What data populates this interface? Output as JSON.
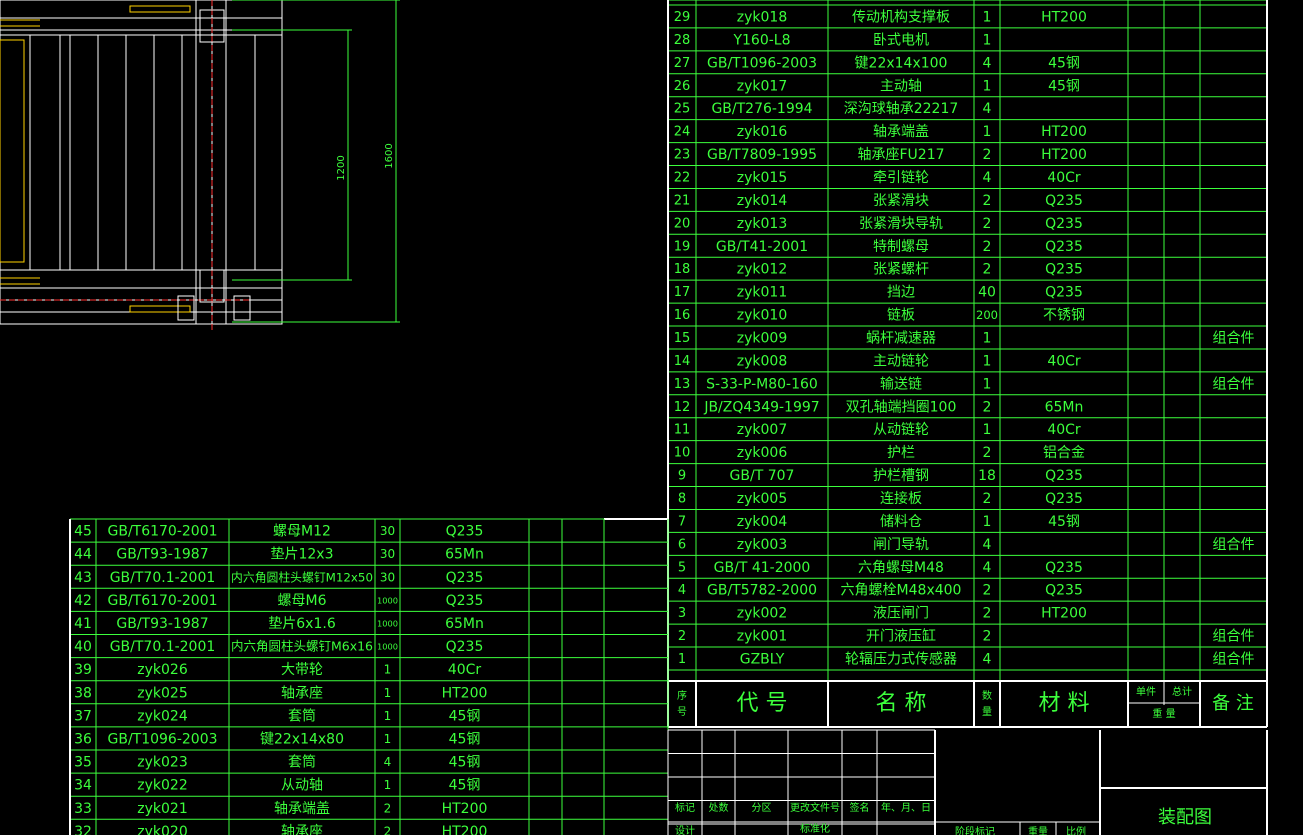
{
  "drawing": {
    "dimensions": [
      "1200",
      "1600"
    ]
  },
  "bom_right": {
    "header": {
      "seq": [
        "序",
        "号"
      ],
      "code": "代    号",
      "name": "名    称",
      "qty": [
        "数",
        "量"
      ],
      "material": "材   料",
      "unit_weight": "单件",
      "total_weight": "总计",
      "weight": "重      量",
      "note": "备 注"
    },
    "rows": [
      {
        "no": "29",
        "code": "zyk018",
        "name": "传动机构支撑板",
        "qty": "1",
        "material": "HT200",
        "note": ""
      },
      {
        "no": "28",
        "code": "Y160-L8",
        "name": "卧式电机",
        "qty": "1",
        "material": "",
        "note": ""
      },
      {
        "no": "27",
        "code": "GB/T1096-2003",
        "name": "键22x14x100",
        "qty": "4",
        "material": "45钢",
        "note": ""
      },
      {
        "no": "26",
        "code": "zyk017",
        "name": "主动轴",
        "qty": "1",
        "material": "45钢",
        "note": ""
      },
      {
        "no": "25",
        "code": "GB/T276-1994",
        "name": "深沟球轴承22217",
        "qty": "4",
        "material": "",
        "note": ""
      },
      {
        "no": "24",
        "code": "zyk016",
        "name": "轴承端盖",
        "qty": "1",
        "material": "HT200",
        "note": ""
      },
      {
        "no": "23",
        "code": "GB/T7809-1995",
        "name": "轴承座FU217",
        "qty": "2",
        "material": "HT200",
        "note": ""
      },
      {
        "no": "22",
        "code": "zyk015",
        "name": "牵引链轮",
        "qty": "4",
        "material": "40Cr",
        "note": ""
      },
      {
        "no": "21",
        "code": "zyk014",
        "name": "张紧滑块",
        "qty": "2",
        "material": "Q235",
        "note": ""
      },
      {
        "no": "20",
        "code": "zyk013",
        "name": "张紧滑块导轨",
        "qty": "2",
        "material": "Q235",
        "note": ""
      },
      {
        "no": "19",
        "code": "GB/T41-2001",
        "name": "特制螺母",
        "qty": "2",
        "material": "Q235",
        "note": ""
      },
      {
        "no": "18",
        "code": "zyk012",
        "name": "张紧螺杆",
        "qty": "2",
        "material": "Q235",
        "note": ""
      },
      {
        "no": "17",
        "code": "zyk011",
        "name": "挡边",
        "qty": "40",
        "material": "Q235",
        "note": ""
      },
      {
        "no": "16",
        "code": "zyk010",
        "name": "链板",
        "qty": "200",
        "material": "不锈钢",
        "note": ""
      },
      {
        "no": "15",
        "code": "zyk009",
        "name": "蜗杆减速器",
        "qty": "1",
        "material": "",
        "note": "组合件"
      },
      {
        "no": "14",
        "code": "zyk008",
        "name": "主动链轮",
        "qty": "1",
        "material": "40Cr",
        "note": ""
      },
      {
        "no": "13",
        "code": "S-33-P-M80-160",
        "name": "输送链",
        "qty": "1",
        "material": "",
        "note": "组合件"
      },
      {
        "no": "12",
        "code": "JB/ZQ4349-1997",
        "name": "双孔轴端挡圈100",
        "qty": "2",
        "material": "65Mn",
        "note": ""
      },
      {
        "no": "11",
        "code": "zyk007",
        "name": "从动链轮",
        "qty": "1",
        "material": "40Cr",
        "note": ""
      },
      {
        "no": "10",
        "code": "zyk006",
        "name": "护栏",
        "qty": "2",
        "material": "铝合金",
        "note": ""
      },
      {
        "no": "9",
        "code": "GB/T 707",
        "name": "护栏槽钢",
        "qty": "18",
        "material": "Q235",
        "note": ""
      },
      {
        "no": "8",
        "code": "zyk005",
        "name": "连接板",
        "qty": "2",
        "material": "Q235",
        "note": ""
      },
      {
        "no": "7",
        "code": "zyk004",
        "name": "储料仓",
        "qty": "1",
        "material": "45钢",
        "note": ""
      },
      {
        "no": "6",
        "code": "zyk003",
        "name": "闸门导轨",
        "qty": "4",
        "material": "",
        "note": "组合件"
      },
      {
        "no": "5",
        "code": "GB/T 41-2000",
        "name": "六角螺母M48",
        "qty": "4",
        "material": "Q235",
        "note": ""
      },
      {
        "no": "4",
        "code": "GB/T5782-2000",
        "name": "六角螺栓M48x400",
        "qty": "2",
        "material": "Q235",
        "note": ""
      },
      {
        "no": "3",
        "code": "zyk002",
        "name": "液压闸门",
        "qty": "2",
        "material": "HT200",
        "note": ""
      },
      {
        "no": "2",
        "code": "zyk001",
        "name": "开门液压缸",
        "qty": "2",
        "material": "",
        "note": "组合件"
      },
      {
        "no": "1",
        "code": "GZBLY",
        "name": "轮辐压力式传感器",
        "qty": "4",
        "material": "",
        "note": "组合件"
      }
    ]
  },
  "bom_left": {
    "rows": [
      {
        "no": "45",
        "code": "GB/T6170-2001",
        "name": "螺母M12",
        "qty": "30",
        "material": "Q235"
      },
      {
        "no": "44",
        "code": "GB/T93-1987",
        "name": "垫片12x3",
        "qty": "30",
        "material": "65Mn"
      },
      {
        "no": "43",
        "code": "GB/T70.1-2001",
        "name": "内六角圆柱头螺钉M12x50",
        "qty": "30",
        "material": "Q235"
      },
      {
        "no": "42",
        "code": "GB/T6170-2001",
        "name": "螺母M6",
        "qty": "1000",
        "material": "Q235"
      },
      {
        "no": "41",
        "code": "GB/T93-1987",
        "name": "垫片6x1.6",
        "qty": "1000",
        "material": "65Mn"
      },
      {
        "no": "40",
        "code": "GB/T70.1-2001",
        "name": "内六角圆柱头螺钉M6x16",
        "qty": "1000",
        "material": "Q235"
      },
      {
        "no": "39",
        "code": "zyk026",
        "name": "大带轮",
        "qty": "1",
        "material": "40Cr"
      },
      {
        "no": "38",
        "code": "zyk025",
        "name": "轴承座",
        "qty": "1",
        "material": "HT200"
      },
      {
        "no": "37",
        "code": "zyk024",
        "name": "套筒",
        "qty": "1",
        "material": "45钢"
      },
      {
        "no": "36",
        "code": "GB/T1096-2003",
        "name": "键22x14x80",
        "qty": "1",
        "material": "45钢"
      },
      {
        "no": "35",
        "code": "zyk023",
        "name": "套筒",
        "qty": "4",
        "material": "45钢"
      },
      {
        "no": "34",
        "code": "zyk022",
        "name": "从动轴",
        "qty": "1",
        "material": "45钢"
      },
      {
        "no": "33",
        "code": "zyk021",
        "name": "轴承端盖",
        "qty": "2",
        "material": "HT200"
      },
      {
        "no": "32",
        "code": "zyk020",
        "name": "轴承座",
        "qty": "2",
        "material": "HT200"
      }
    ]
  },
  "title_block": {
    "labels": [
      "标记",
      "处数",
      "分区",
      "更改文件号",
      "签名",
      "年、月、日"
    ],
    "design_label": "设计",
    "standard_label": "标准化",
    "stage_label": "阶段标记",
    "weight_label": "重量",
    "scale_label": "比例",
    "drawing_name": "装配图"
  },
  "colors": {
    "line": "#3cff3c",
    "text": "#3cff3c",
    "frame": "#ffffff",
    "background": "#000000"
  }
}
